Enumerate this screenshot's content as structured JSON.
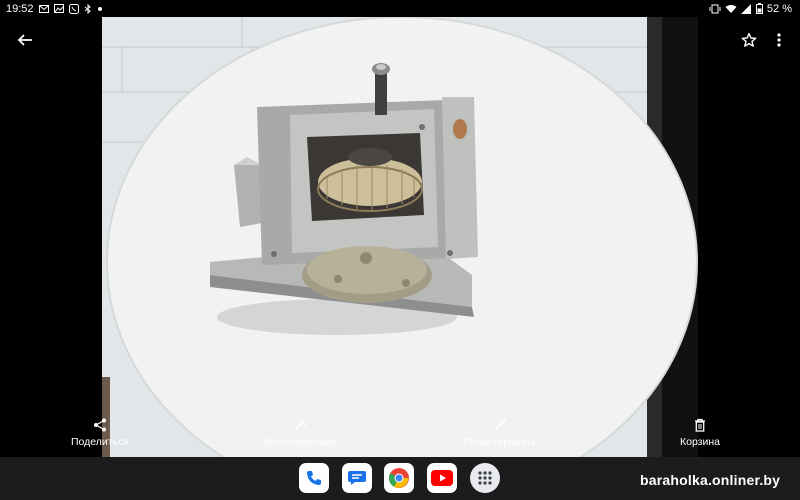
{
  "status_bar": {
    "time": "19:52",
    "battery": "52 %",
    "icons": [
      "gmail-icon",
      "image-icon",
      "viber-icon",
      "bluetooth-icon",
      "dot-icon",
      "vibrate-icon",
      "wifi-icon",
      "signal-icon",
      "battery-icon"
    ]
  },
  "top_bar": {
    "back_icon": "arrow-left-icon",
    "favorite_icon": "star-outline-icon",
    "menu_icon": "more-vert-icon"
  },
  "actions": [
    {
      "label": "Поделиться",
      "icon": "share-icon"
    },
    {
      "label": "Автокоррекция",
      "icon": "magic-wand-icon"
    },
    {
      "label": "Редактировать",
      "icon": "brush-icon"
    },
    {
      "label": "Корзина",
      "icon": "trash-icon"
    }
  ],
  "taskbar": {
    "apps": [
      "phone-app-icon",
      "messages-app-icon",
      "chrome-app-icon",
      "youtube-app-icon",
      "app-drawer-icon"
    ]
  },
  "watermark": "baraholka.onliner.by",
  "colors": {
    "background": "#000000",
    "taskbar": "#1c1c1e",
    "youtube_red": "#ff0000",
    "phone_blue": "#1a73e8"
  }
}
